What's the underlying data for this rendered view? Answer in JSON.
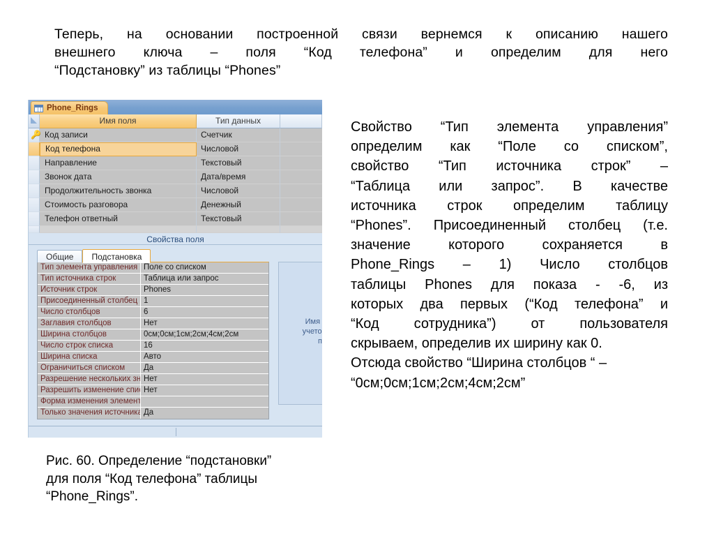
{
  "intro": {
    "lines": [
      "Теперь, на основании построенной связи вернемся к описанию нашего",
      "внешнего ключа – поля “Код телефона” и определим для него",
      "“Подстановку” из таблицы “Phones”"
    ]
  },
  "explanation": {
    "lines": [
      "Свойство “Тип элемента управления”",
      "определим как “Поле со списком”,",
      "свойство “Тип источника строк” –",
      "“Таблица или запрос”. В качестве",
      "источника строк определим таблицу",
      "“Phones”. Присоединенный столбец (т.е.",
      "значение которого сохраняется в",
      "Phone_Rings – 1) Число столбцов",
      "таблицы Phones для показа - -6, из",
      "которых два первых (“Код телефона” и",
      "“Код сотрудника”) от пользователя",
      "скрываем, определив их ширину как 0.",
      "Отсюда свойство “Ширина столбцов “ –",
      "“0см;0см;1см;2см;4см;2см”"
    ]
  },
  "caption": {
    "lines": [
      "Рис. 60. Определение “подстановки”",
      "для поля “Код телефона” таблицы",
      "“Phone_Rings”."
    ]
  },
  "access_window": {
    "document_tab": {
      "title": "Phone_Rings",
      "icon": "table-grid-icon"
    },
    "design_grid": {
      "headers": {
        "field_name": "Имя поля",
        "data_type": "Тип данных",
        "description": ""
      },
      "rows": [
        {
          "key": "key-icon",
          "name": "Код записи",
          "type": "Счетчик",
          "selected": false
        },
        {
          "key": "",
          "name": "Код телефона",
          "type": "Числовой",
          "selected": true
        },
        {
          "key": "",
          "name": "Направление",
          "type": "Текстовый",
          "selected": false
        },
        {
          "key": "",
          "name": "Звонок дата",
          "type": "Дата/время",
          "selected": false
        },
        {
          "key": "",
          "name": "Продолжительность звонка",
          "type": "Числовой",
          "selected": false
        },
        {
          "key": "",
          "name": "Стоимость разговора",
          "type": "Денежный",
          "selected": false
        },
        {
          "key": "",
          "name": "Телефон ответный",
          "type": "Текстовый",
          "selected": false
        }
      ]
    },
    "properties_caption": "Свойства поля",
    "property_tabs": [
      {
        "label": "Общие",
        "active": false
      },
      {
        "label": "Подстановка",
        "active": true
      }
    ],
    "properties": [
      {
        "label": "Тип элемента управления",
        "value": "Поле со списком"
      },
      {
        "label": "Тип источника строк",
        "value": "Таблица или запрос"
      },
      {
        "label": "Источник строк",
        "value": "Phones"
      },
      {
        "label": "Присоединенный столбец",
        "value": "1"
      },
      {
        "label": "Число столбцов",
        "value": "6"
      },
      {
        "label": "Заглавия столбцов",
        "value": "Нет"
      },
      {
        "label": "Ширина столбцов",
        "value": "0см;0см;1см;2см;4см;2см"
      },
      {
        "label": "Число строк списка",
        "value": "16"
      },
      {
        "label": "Ширина списка",
        "value": "Авто"
      },
      {
        "label": "Ограничиться списком",
        "value": "Да"
      },
      {
        "label": "Разрешение нескольких значений",
        "value": "Нет"
      },
      {
        "label": "Разрешить изменение списка значений",
        "value": "Нет"
      },
      {
        "label": "Форма изменения элементов списка",
        "value": ""
      },
      {
        "label": "Только значения источника",
        "value": "Да"
      }
    ],
    "hint": {
      "lines": [
        "Имя пол",
        "учетом пр",
        "п"
      ]
    }
  },
  "colors": {
    "tab_orange": "#f5c268",
    "titlebar_blue": "#77a0cf",
    "pane_blue": "#d7e4f2",
    "grid_gray": "#c4c4c4",
    "selected_row": "#f7d49a",
    "label_maroon": "#6e2a2a",
    "hint_text": "#3f5e8c"
  }
}
